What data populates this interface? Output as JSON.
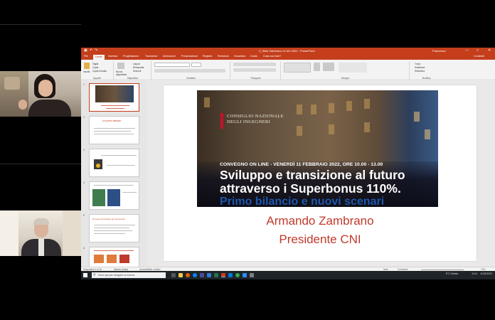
{
  "colors": {
    "ppt_accent": "#c43e1c",
    "slide_red": "#c0392b",
    "headline_blue": "#1f5fbf"
  },
  "window": {
    "title": "3_Slide Zambrano 11 feb 2022 - PowerPoint",
    "user": "Francesco",
    "controls": [
      "—",
      "□",
      "✕"
    ]
  },
  "ribbon": {
    "tabs": [
      "File",
      "Home",
      "Inserisci",
      "Progettazione",
      "Transizioni",
      "Animazioni",
      "Presentazione",
      "Registra",
      "Revisione",
      "Visualizza",
      "Guida",
      "Cosa vuoi fare?"
    ],
    "active_tab": "Home",
    "share": "Condividi",
    "groups": [
      "Appunti",
      "Diapositive",
      "Carattere",
      "Paragrafo",
      "Disegno",
      "Modifica"
    ],
    "clipboard_items": [
      "Taglia",
      "Copia",
      "Copia formato"
    ],
    "paste": "Incolla",
    "slides_items": [
      "Layout",
      "Reimposta",
      "Sezione"
    ],
    "new_slide": "Nuova diapositiva",
    "editing_items": [
      "Trova",
      "Sostituisci",
      "Seleziona"
    ]
  },
  "thumbnails": [
    {
      "num": "1",
      "title": ""
    },
    {
      "num": "2",
      "title": "Un primo bilancio"
    },
    {
      "num": "3",
      "title": ""
    },
    {
      "num": "4",
      "title": ""
    },
    {
      "num": "5",
      "title": "Di cosa c'è bisogno per la crescita"
    },
    {
      "num": "6",
      "title": ""
    }
  ],
  "slide": {
    "org": "CONSIGLIO NAZIONALE",
    "org2": "DEGLI INGEGNERI",
    "event": "CONVEGNO ON LINE - VENERDÌ 11 FEBBRAIO 2022, ORE 10.00 - 13.00",
    "headline1": "Sviluppo e transizione al futuro",
    "headline2": "attraverso i Superbonus 110%.",
    "subline": "Primo bilancio e nuovi scenari",
    "speaker": "Armando Zambrano",
    "role": "Presidente CNI"
  },
  "statusbar": {
    "slide_count": "Diapositiva 1 di 15",
    "language": "Italiano (Italia)",
    "accessibility": "Accessibilità: verifica",
    "notes": "Note",
    "comments": "Commenti",
    "zoom": "72%"
  },
  "taskbar": {
    "search_placeholder": "Scrivi qui per eseguire la ricerca",
    "weather": "8°C Nebbia",
    "time": "10:11",
    "date": "11/02/2022"
  }
}
